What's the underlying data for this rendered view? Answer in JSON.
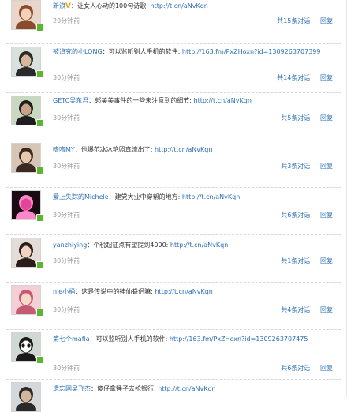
{
  "sep": "：",
  "bar": "|",
  "items": [
    {
      "user": "新浪",
      "has_v": true,
      "v": "V",
      "text": "让女人心动的100句诗歌:",
      "link": "http://t.cn/aNvKqn",
      "time": "29分钟前",
      "forward": "共15条对话",
      "reply": "回复",
      "avatar": {
        "bg": "#e9d6c8",
        "face": "#f3d2b8",
        "hair": "#8a4b2e"
      }
    },
    {
      "user": "被追究的小LONG",
      "has_v": false,
      "text": "可以监听别人手机的软件:",
      "link": "http://163.fm/PxZHoxn?id=1309263707399",
      "time": "30分钟前",
      "forward": "共14条对话",
      "reply": "回复",
      "avatar": {
        "bg": "#d9e1dc",
        "face": "#d8b79a",
        "hair": "#2a2a2a"
      }
    },
    {
      "user": "GETC吴东君",
      "has_v": false,
      "text": "郭美美事件的一些未注意到的细节:",
      "link": "http://t.cn/aNvKqn",
      "time": "30分钟前",
      "forward": "共5条对话",
      "reply": "回复",
      "avatar": {
        "bg": "#c9d8c0",
        "face": "#c9a387",
        "hair": "#1e1e1e"
      }
    },
    {
      "user": "嗜嗜MY",
      "has_v": false,
      "text": "他爆范冰冰艳照真流出了:",
      "link": "http://t.cn/aNvKqn",
      "time": "30分钟前",
      "forward": "共3条对话",
      "reply": "回复",
      "avatar": {
        "bg": "#d7c6b6",
        "face": "#e9c9ad",
        "hair": "#3b2a20"
      }
    },
    {
      "user": "爱上失踪的Michele",
      "has_v": false,
      "text": "建党大业中穿帮的地方:",
      "link": "http://t.cn/aNvKqn",
      "time": "30分钟前",
      "forward": "共6条对话",
      "reply": "回复",
      "avatar": {
        "bg": "#1a0a14",
        "face": "#e2449a",
        "hair": "#ff86c8"
      }
    },
    {
      "user": "yanzhiying",
      "has_v": false,
      "text": "个税起征点有望提到4000:",
      "link": "http://t.cn/aNvKqn",
      "time": "30分钟前",
      "forward": "共1条对话",
      "reply": "回复",
      "avatar": {
        "bg": "#e4dcd8",
        "face": "#f0d3c2",
        "hair": "#2b1e1a"
      }
    },
    {
      "user": "nie小桶",
      "has_v": false,
      "text": "这是传说中的神仙眷侣嘛:",
      "link": "http://t.cn/aNvKqn",
      "time": "30分钟前",
      "forward": "共4条对话",
      "reply": "回复",
      "avatar": {
        "bg": "#f3cfd6",
        "face": "#f6d9c8",
        "hair": "#c45a74"
      }
    },
    {
      "user": "第七个mafia",
      "has_v": false,
      "text": "可以监听别人手机的软件:",
      "link": "http://163.fm/PxZHoxn?id=1309263707475",
      "time": "30分钟前",
      "forward": "共6条对话",
      "reply": "回复",
      "avatar": {
        "bg": "#cfd8d2",
        "face": "#ffffff",
        "hair": "#1a1a1a"
      }
    },
    {
      "user": "遗忘网吴飞杰",
      "has_v": false,
      "text": "傻仔拿锤子去抢银行:",
      "link": "http://t.cn/aNvKqn",
      "time": "",
      "forward": "",
      "reply": "",
      "avatar": {
        "bg": "#d5d8da",
        "face": "#d4b69c",
        "hair": "#2a2a2a"
      }
    }
  ]
}
